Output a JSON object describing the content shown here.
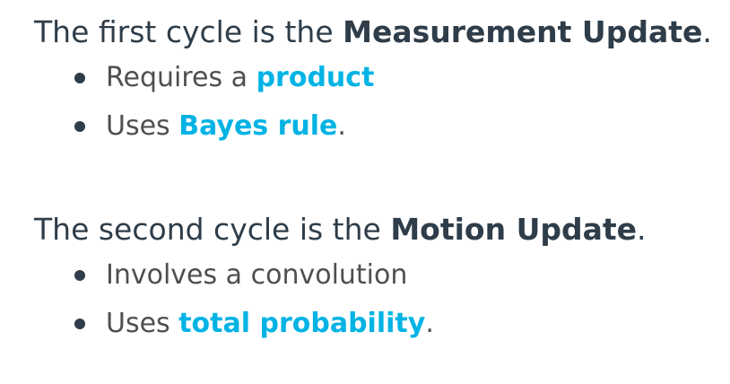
{
  "sections": [
    {
      "heading_prefix": "The first cycle is the ",
      "heading_bold": "Measurement Update",
      "heading_suffix": ".",
      "bullets": [
        {
          "text": "Requires a ",
          "link": "product",
          "suffix": ""
        },
        {
          "text": "Uses ",
          "link": "Bayes rule",
          "suffix": "."
        }
      ]
    },
    {
      "heading_prefix": "The second cycle is the ",
      "heading_bold": "Motion Update",
      "heading_suffix": ".",
      "bullets": [
        {
          "text": "Involves a convolution",
          "link": "",
          "suffix": ""
        },
        {
          "text": "Uses ",
          "link": "total probability",
          "suffix": "."
        }
      ]
    }
  ],
  "colors": {
    "heading": "#2e3d49",
    "body_text": "#4f4f4f",
    "link": "#02b3e4",
    "bullet": "#2e3d49"
  }
}
